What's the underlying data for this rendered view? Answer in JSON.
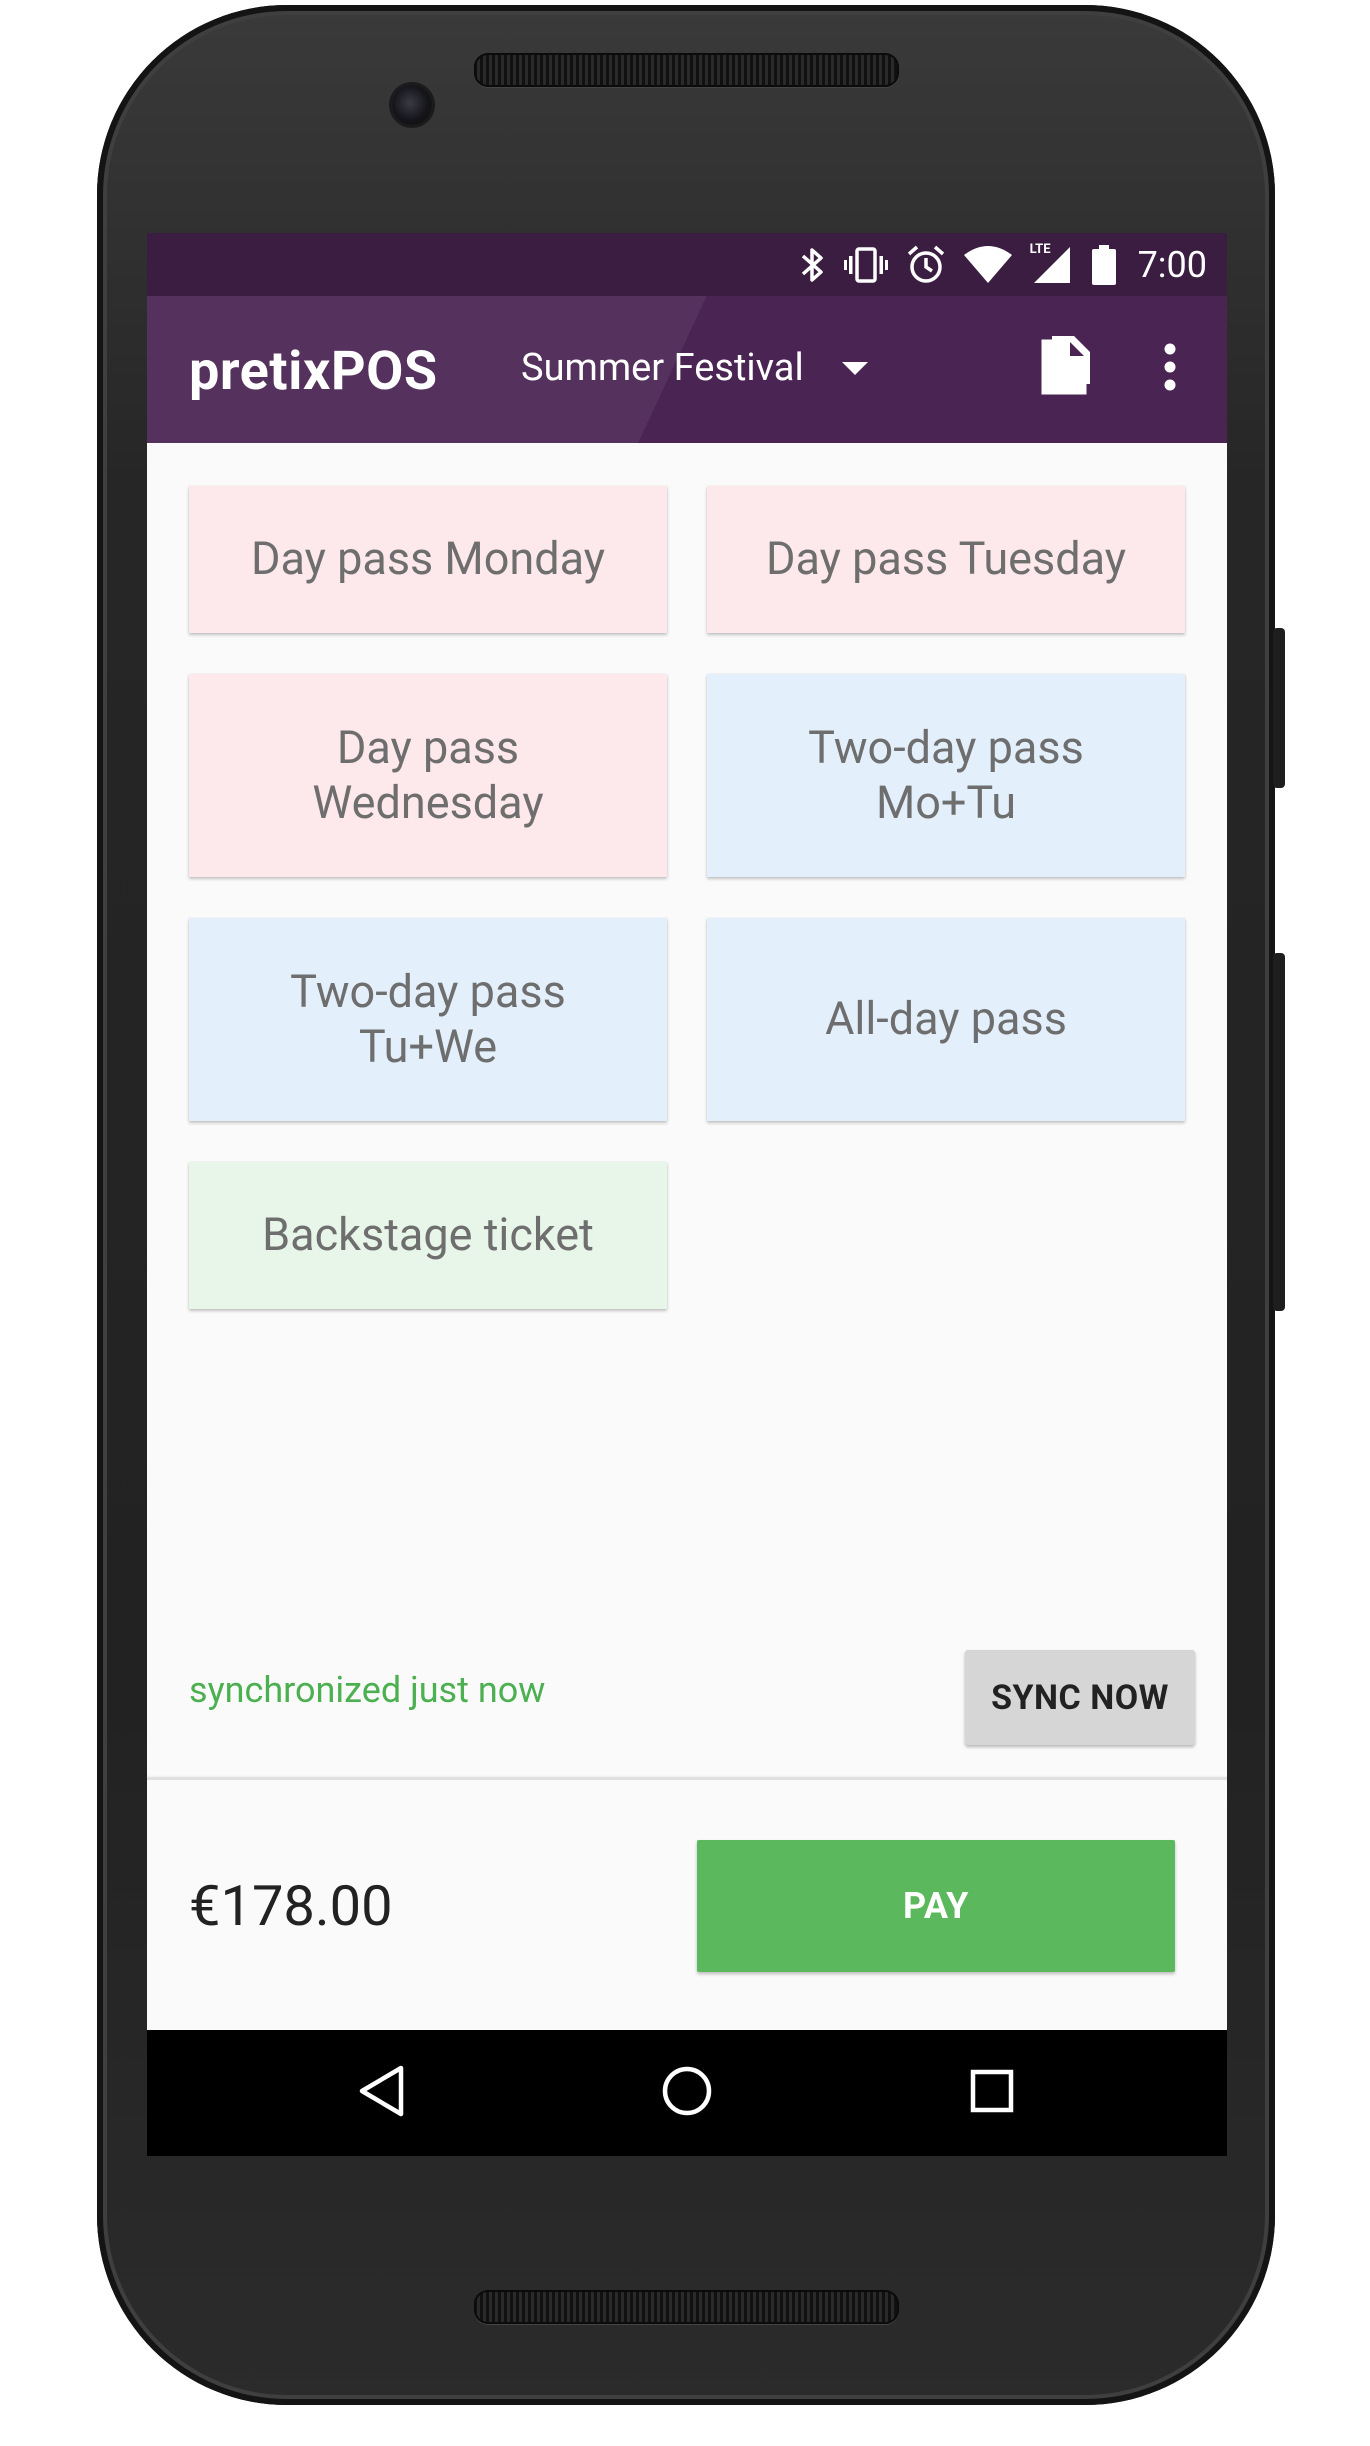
{
  "status_bar": {
    "time": "7:00",
    "icons": [
      "bluetooth-icon",
      "vibrate-icon",
      "alarm-icon",
      "wifi-icon",
      "lte-signal-icon",
      "battery-icon"
    ],
    "network_label": "LTE"
  },
  "toolbar": {
    "title": "pretixPOS",
    "event": "Summer Festival",
    "actions": [
      "document-icon",
      "overflow-menu-icon"
    ]
  },
  "products": [
    {
      "label": "Day pass Monday",
      "color": "#fde8ec"
    },
    {
      "label": "Day pass Tuesday",
      "color": "#fde8ec"
    },
    {
      "label": "Day pass\nWednesday",
      "color": "#fde8ec"
    },
    {
      "label": "Two-day pass\nMo+Tu",
      "color": "#e3f0fc"
    },
    {
      "label": "Two-day pass\nTu+We",
      "color": "#e3f0fc"
    },
    {
      "label": "All-day pass",
      "color": "#e3f0fc"
    },
    {
      "label": "Backstage ticket",
      "color": "#e8f5e9"
    }
  ],
  "sync": {
    "status": "synchronized just now",
    "button_label": "SYNC NOW",
    "status_color": "#4caf50"
  },
  "cart": {
    "total": "€178.00",
    "pay_label": "PAY",
    "pay_color": "#5cb85c"
  },
  "colors": {
    "status_bar": "#3b1d42",
    "toolbar": "#4a2553"
  },
  "nav": {
    "buttons": [
      "back-icon",
      "home-icon",
      "recents-icon"
    ]
  }
}
